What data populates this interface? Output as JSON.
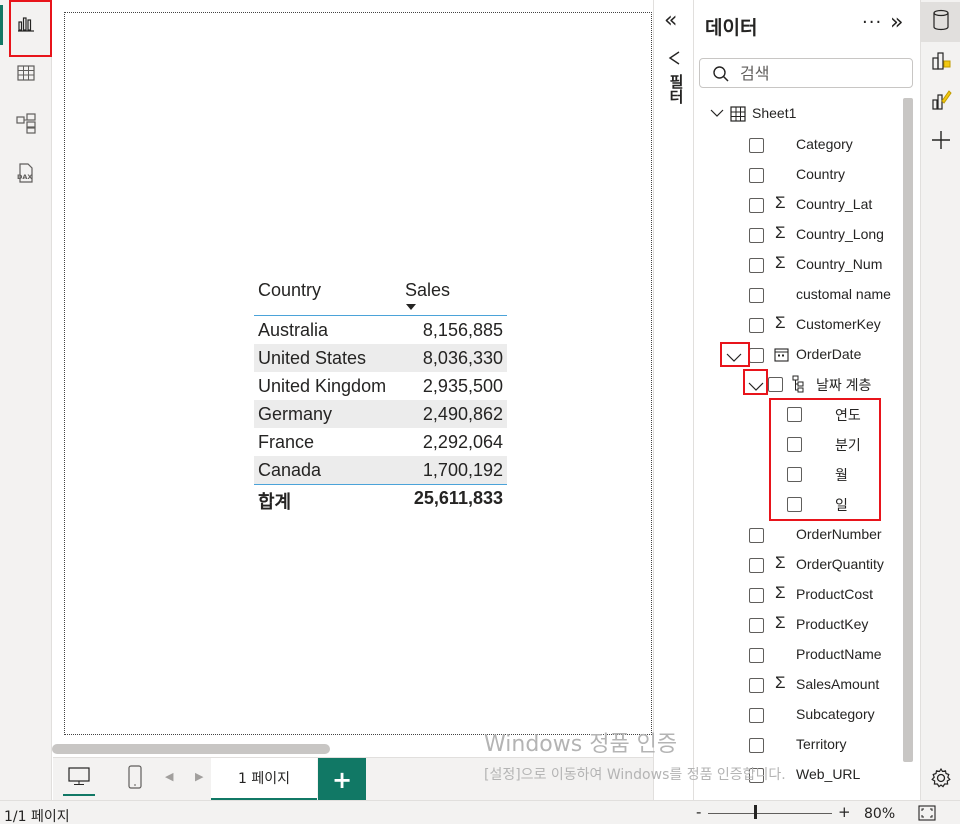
{
  "left_rail": {
    "items": [
      {
        "name": "report-view",
        "icon": "bar-chart-icon",
        "active": true
      },
      {
        "name": "table-view",
        "icon": "table-grid-icon"
      },
      {
        "name": "model-view",
        "icon": "model-icon"
      },
      {
        "name": "dax-query-view",
        "icon": "dax-icon",
        "icon_text": "DAX"
      }
    ]
  },
  "table_visual": {
    "columns": [
      "Country",
      "Sales"
    ],
    "rows": [
      [
        "Australia",
        "8,156,885"
      ],
      [
        "United States",
        "8,036,330"
      ],
      [
        "United Kingdom",
        "2,935,500"
      ],
      [
        "Germany",
        "2,490,862"
      ],
      [
        "France",
        "2,292,064"
      ],
      [
        "Canada",
        "1,700,192"
      ]
    ],
    "total_label": "합계",
    "total_value": "25,611,833"
  },
  "page_bar": {
    "tab_label": "1 페이지",
    "add_label": "+",
    "accent": "#117865"
  },
  "status_bar": {
    "page_info": "1/1 페이지",
    "zoom_minus": "-",
    "zoom_plus": "+",
    "zoom_level": "80%"
  },
  "filter_pane": {
    "collapse_glyph": "«",
    "label": "필터"
  },
  "data_pane": {
    "title": "데이터",
    "more_glyph": "···",
    "expand_glyph": "»",
    "search_placeholder": "검색",
    "table_name": "Sheet1",
    "fields": [
      {
        "label": "Category",
        "sigma": false
      },
      {
        "label": "Country",
        "sigma": false
      },
      {
        "label": "Country_Lat",
        "sigma": true
      },
      {
        "label": "Country_Long",
        "sigma": true
      },
      {
        "label": "Country_Num",
        "sigma": true
      },
      {
        "label": "customal name",
        "sigma": false
      },
      {
        "label": "CustomerKey",
        "sigma": true
      }
    ],
    "order_date": {
      "label": "OrderDate"
    },
    "date_hierarchy": {
      "label": "날짜 계층",
      "levels": [
        "연도",
        "분기",
        "월",
        "일"
      ]
    },
    "fields_after": [
      {
        "label": "OrderNumber",
        "sigma": false
      },
      {
        "label": "OrderQuantity",
        "sigma": true
      },
      {
        "label": "ProductCost",
        "sigma": true
      },
      {
        "label": "ProductKey",
        "sigma": true
      },
      {
        "label": "ProductName",
        "sigma": false
      },
      {
        "label": "SalesAmount",
        "sigma": true
      },
      {
        "label": "Subcategory",
        "sigma": false
      },
      {
        "label": "Territory",
        "sigma": false
      },
      {
        "label": "Web_URL",
        "sigma": false
      }
    ]
  },
  "right_rail": {
    "items": [
      "data-pane-icon",
      "build-visual-icon",
      "format-visual-icon",
      "add-pane-icon",
      "settings-icon"
    ]
  },
  "watermark": {
    "line1": "Windows 정품 인증",
    "line2": "[설정]으로 이동하여 Windows를 정품 인증합니다."
  },
  "colors": {
    "highlight_red": "#e8141b",
    "accent_teal": "#117865",
    "table_rule": "#4ba3d9"
  }
}
